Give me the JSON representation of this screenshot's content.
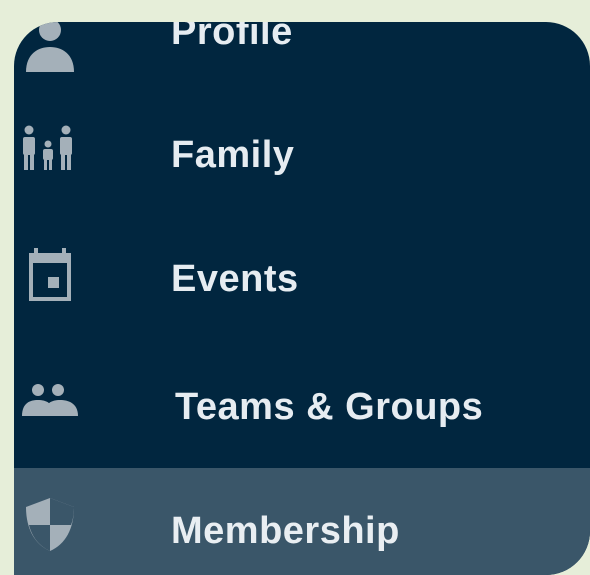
{
  "sidebar": {
    "items": [
      {
        "label": "Profile",
        "icon": "person-icon",
        "active": false
      },
      {
        "label": "Family",
        "icon": "family-icon",
        "active": false
      },
      {
        "label": "Events",
        "icon": "calendar-icon",
        "active": false
      },
      {
        "label": "Teams & Groups",
        "icon": "people-group-icon",
        "active": false
      },
      {
        "label": "Membership",
        "icon": "shield-icon",
        "active": true
      }
    ]
  },
  "colors": {
    "page_background": "#e6eed9",
    "sidebar_background": "#01263f",
    "active_item_background": "#3a5669",
    "icon_color": "#a4b0b9",
    "label_color": "#e6ecf1"
  }
}
